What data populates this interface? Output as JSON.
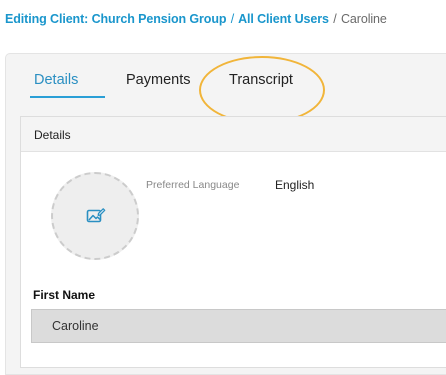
{
  "breadcrumb": {
    "prefix": "Editing Client: Church Pension Group",
    "separator": "/",
    "section": "All Client Users",
    "current": "Caroline"
  },
  "tabs": {
    "details": "Details",
    "payments": "Payments",
    "transcript": "Transcript",
    "active": "details"
  },
  "card": {
    "title": "Details"
  },
  "avatar": {
    "icon": "image-edit-icon"
  },
  "preferred_language": {
    "label": "Preferred Language",
    "value": "English"
  },
  "first_name": {
    "label": "First Name",
    "value": "Caroline"
  },
  "colors": {
    "link": "#1a96cc",
    "active_tab": "#2a8fc2",
    "tab_underline": "#2a9fd6",
    "annotation": "#f1b53a"
  }
}
